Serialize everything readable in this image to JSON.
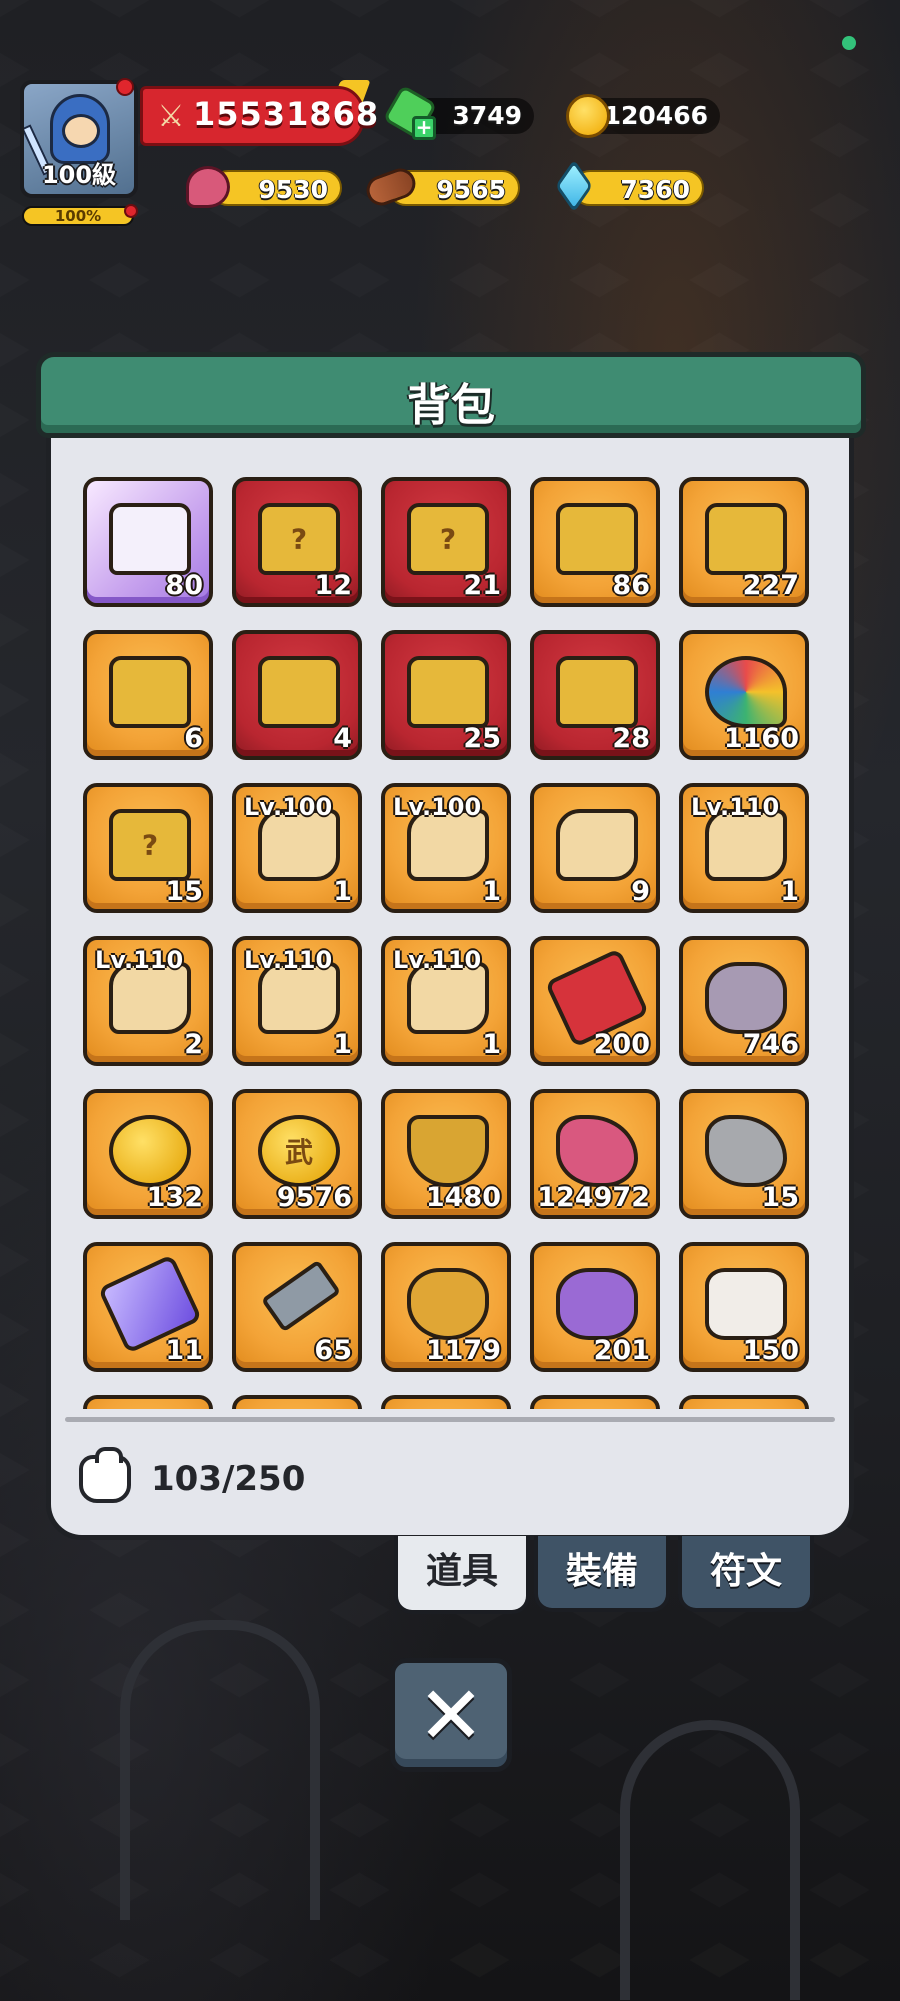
{
  "hud": {
    "level_label": "100級",
    "xp_percent_label": "100%",
    "xp_fraction": 1.0,
    "combat_power": "15531868",
    "top_resources": [
      {
        "icon": "green-gem-icon",
        "value": "3749"
      },
      {
        "icon": "gold-coin-icon",
        "value": "120466"
      }
    ],
    "bottom_resources": [
      {
        "icon": "meat-icon",
        "value": "9530"
      },
      {
        "icon": "wood-log-icon",
        "value": "9565"
      },
      {
        "icon": "crystal-icon",
        "value": "7360"
      }
    ]
  },
  "panel": {
    "title": "背包",
    "capacity": "103/250"
  },
  "items": [
    {
      "icon": "purple-rune-chest-icon",
      "bg": "purple",
      "shape": "chest",
      "qty": "80",
      "lv": ""
    },
    {
      "icon": "mystery-chest-icon",
      "bg": "red",
      "shape": "chest",
      "qty": "12",
      "lv": "",
      "glyph": "?"
    },
    {
      "icon": "purple-mystery-chest-icon",
      "bg": "red",
      "shape": "chest",
      "qty": "21",
      "lv": "",
      "glyph": "?"
    },
    {
      "icon": "teal-chest-icon",
      "bg": "orange",
      "shape": "chest",
      "qty": "86",
      "lv": ""
    },
    {
      "icon": "red-diamond-chest-icon",
      "bg": "orange",
      "shape": "chest",
      "qty": "227",
      "lv": ""
    },
    {
      "icon": "teal-chest-icon",
      "bg": "orange",
      "shape": "chest",
      "qty": "6",
      "lv": ""
    },
    {
      "icon": "winged-blue-chest-icon",
      "bg": "red",
      "shape": "chest",
      "qty": "4",
      "lv": ""
    },
    {
      "icon": "winged-purple-chest-icon",
      "bg": "red",
      "shape": "chest",
      "qty": "25",
      "lv": ""
    },
    {
      "icon": "winged-purple-chest-icon",
      "bg": "red",
      "shape": "chest",
      "qty": "28",
      "lv": ""
    },
    {
      "icon": "pinwheel-icon",
      "bg": "orange",
      "shape": "pin",
      "qty": "1160",
      "lv": ""
    },
    {
      "icon": "red-mystery-chest-icon",
      "bg": "orange",
      "shape": "chest",
      "qty": "15",
      "lv": "",
      "glyph": "?"
    },
    {
      "icon": "horn-scroll-icon",
      "bg": "orange",
      "shape": "scroll",
      "qty": "1",
      "lv": "Lv.100"
    },
    {
      "icon": "horn-scroll-icon",
      "bg": "orange",
      "shape": "scroll",
      "qty": "1",
      "lv": "Lv.100"
    },
    {
      "icon": "rolled-scroll-icon",
      "bg": "orange",
      "shape": "scroll",
      "qty": "9",
      "lv": ""
    },
    {
      "icon": "blueprint-scroll-icon",
      "bg": "orange",
      "shape": "scroll",
      "qty": "1",
      "lv": "Lv.110"
    },
    {
      "icon": "blueprint-scroll-icon",
      "bg": "orange",
      "shape": "scroll",
      "qty": "2",
      "lv": "Lv.110"
    },
    {
      "icon": "blueprint-scroll-icon",
      "bg": "orange",
      "shape": "scroll",
      "qty": "1",
      "lv": "Lv.110"
    },
    {
      "icon": "blueprint-scroll-icon",
      "bg": "orange",
      "shape": "scroll",
      "qty": "1",
      "lv": "Lv.110"
    },
    {
      "icon": "star-gem-icon",
      "bg": "orange",
      "shape": "gem-red",
      "qty": "200",
      "lv": ""
    },
    {
      "icon": "stone-slab-icon",
      "bg": "orange",
      "shape": "stone",
      "qty": "746",
      "lv": ""
    },
    {
      "icon": "shirt-coin-icon",
      "bg": "orange",
      "shape": "coin",
      "qty": "132",
      "lv": ""
    },
    {
      "icon": "martial-coin-icon",
      "bg": "orange",
      "shape": "coin",
      "qty": "9576",
      "lv": "",
      "glyph": "武"
    },
    {
      "icon": "sword-shield-emblem-icon",
      "bg": "orange",
      "shape": "shield",
      "qty": "1480",
      "lv": ""
    },
    {
      "icon": "pink-ore-icon",
      "bg": "orange",
      "shape": "ore-pink",
      "qty": "124972",
      "lv": ""
    },
    {
      "icon": "gray-ore-icon",
      "bg": "orange",
      "shape": "ore-gray",
      "qty": "15",
      "lv": ""
    },
    {
      "icon": "purple-crystal-icon",
      "bg": "orange",
      "shape": "gem",
      "qty": "11",
      "lv": ""
    },
    {
      "icon": "hammer-icon",
      "bg": "orange",
      "shape": "hammer",
      "qty": "65",
      "lv": ""
    },
    {
      "icon": "winged-star-badge-icon",
      "bg": "orange",
      "shape": "badge",
      "qty": "1179",
      "lv": ""
    },
    {
      "icon": "spiral-rune-stone-icon",
      "bg": "orange",
      "shape": "stone-purple",
      "qty": "201",
      "lv": ""
    },
    {
      "icon": "swirl-rune-stone-icon",
      "bg": "orange",
      "shape": "octa",
      "qty": "150",
      "lv": ""
    }
  ],
  "partial_row_count": 5,
  "tabs": [
    {
      "label": "道具",
      "active": true
    },
    {
      "label": "裝備",
      "active": false
    },
    {
      "label": "符文",
      "active": false
    }
  ],
  "close_icon": "close-x-icon",
  "colors": {
    "accent_green": "#3f8c72",
    "slot_orange": "#f3a337",
    "slot_red": "#b92630",
    "power_red": "#d7262e",
    "resource_yellow": "#f5c524"
  }
}
